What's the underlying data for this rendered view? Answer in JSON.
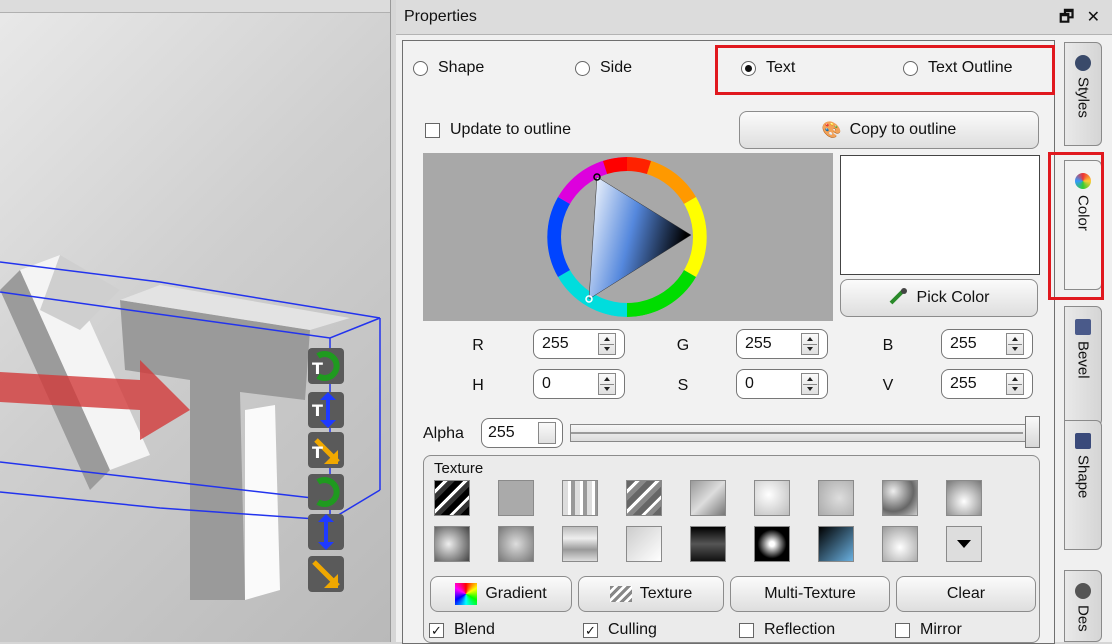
{
  "panel": {
    "title": "Properties",
    "window_controls": "🗗 ✕"
  },
  "mode": {
    "options": [
      "Shape",
      "Side",
      "Text",
      "Text Outline"
    ],
    "selected": "Text"
  },
  "color": {
    "update_outline_label": "Update to outline",
    "update_outline_checked": false,
    "copy_outline_label": "Copy to outline",
    "pick_color_label": "Pick Color",
    "preview_color": "#ffffff",
    "fields": [
      {
        "label": "R",
        "value": "255"
      },
      {
        "label": "G",
        "value": "255"
      },
      {
        "label": "B",
        "value": "255"
      },
      {
        "label": "H",
        "value": "0"
      },
      {
        "label": "S",
        "value": "0"
      },
      {
        "label": "V",
        "value": "255"
      }
    ],
    "alpha_label": "Alpha",
    "alpha_value": "255",
    "alpha_level": 1.0
  },
  "texture": {
    "group_label": "Texture",
    "buttons": [
      "Gradient",
      "Texture",
      "Multi-Texture",
      "Clear"
    ]
  },
  "options": [
    {
      "label": "Blend",
      "checked": true
    },
    {
      "label": "Culling",
      "checked": true
    },
    {
      "label": "Reflection",
      "checked": false
    },
    {
      "label": "Mirror",
      "checked": false
    }
  ],
  "side_tabs": [
    "Styles",
    "Color",
    "Bevel",
    "Shape",
    "Des"
  ],
  "active_tab": "Color",
  "colors": {
    "highlight": "#e0181e",
    "bounding_box": "#2233ee"
  }
}
